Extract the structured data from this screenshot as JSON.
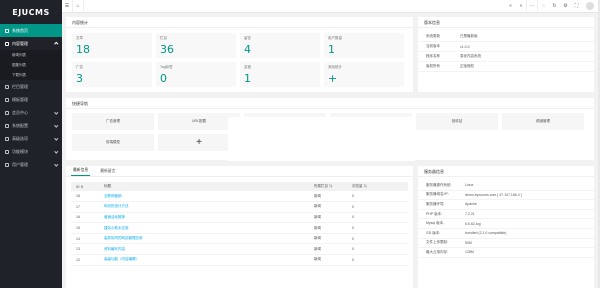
{
  "logo": "EJUCMS",
  "sidebar": {
    "items": [
      {
        "label": "系统首页"
      },
      {
        "label": "内容管理"
      },
      {
        "label": "栏目管理"
      },
      {
        "label": "模板管理"
      },
      {
        "label": "会员中心"
      },
      {
        "label": "系统配置"
      },
      {
        "label": "高级选项"
      },
      {
        "label": "功能模块"
      },
      {
        "label": "用户管理"
      }
    ],
    "sub_items": [
      {
        "label": "新闻列表"
      },
      {
        "label": "图集列表"
      },
      {
        "label": "下载列表"
      }
    ]
  },
  "header": {
    "home_icon": "home-icon",
    "menu_icon": "menu-icon"
  },
  "stats": {
    "title": "内容统计",
    "items": [
      {
        "label": "文章",
        "value": "18"
      },
      {
        "label": "栏目",
        "value": "36"
      },
      {
        "label": "留言",
        "value": "4"
      },
      {
        "label": "用户数量",
        "value": "1"
      },
      {
        "label": "广告",
        "value": "3"
      },
      {
        "label": "Tag标签",
        "value": "0"
      },
      {
        "label": "友链",
        "value": "1"
      },
      {
        "label": "添加统计",
        "value": "+"
      }
    ]
  },
  "version": {
    "title": "版本信息",
    "rows": [
      {
        "k": "系统更新",
        "v": "已是最新版"
      },
      {
        "k": "当前版本",
        "v": "v1.0.0"
      },
      {
        "k": "程序名称",
        "v": "易优内容系统"
      },
      {
        "k": "版权所有",
        "v": "正版授权"
      }
    ]
  },
  "quick": {
    "title": "快捷导航",
    "items": [
      {
        "label": "广告管理"
      },
      {
        "label": "URL配置"
      },
      {
        "label": ""
      },
      {
        "label": "SEO管理"
      },
      {
        "label": "回收站"
      },
      {
        "label": "频道管理"
      },
      {
        "label": "前端模型"
      },
      {
        "label": "+"
      }
    ]
  },
  "latest": {
    "tabs": [
      "最新信息",
      "最新留言"
    ],
    "columns": [
      "ID",
      "标题",
      "所属栏目",
      "浏览量"
    ],
    "rows": [
      {
        "id": "18",
        "title": "互联网营销",
        "cat": "新闻",
        "views": "0"
      },
      {
        "id": "17",
        "title": "网页的设计方法",
        "cat": "新闻",
        "views": "0"
      },
      {
        "id": "16",
        "title": "营销活动推荐",
        "cat": "新闻",
        "views": "0"
      },
      {
        "id": "15",
        "title": "建站小助手应用",
        "cat": "新闻",
        "views": "0"
      },
      {
        "id": "14",
        "title": "高效协同的网站管理应用",
        "cat": "新闻",
        "views": "0"
      },
      {
        "id": "13",
        "title": "资料编写内容",
        "cat": "新闻",
        "views": "0"
      },
      {
        "id": "12",
        "title": "高级功能（内容编辑）",
        "cat": "新闻",
        "views": "0"
      }
    ]
  },
  "server": {
    "title": "服务器信息",
    "rows": [
      {
        "k": "服务器操作系统:",
        "v": "Linux"
      },
      {
        "k": "服务器域名/IP:",
        "v": "demo.eyoucms.com [ 47.107.166.4 ]"
      },
      {
        "k": "服务器环境:",
        "v": "Apache"
      },
      {
        "k": "PHP 版本:",
        "v": "7.2.21"
      },
      {
        "k": "Mysql 版本:",
        "v": "5.5.62-log"
      },
      {
        "k": "GD 版本:",
        "v": "bundled (2.1.0 compatible)"
      },
      {
        "k": "文件上传限制:",
        "v": "50M"
      },
      {
        "k": "最大占用内存:",
        "v": "128M"
      }
    ]
  }
}
